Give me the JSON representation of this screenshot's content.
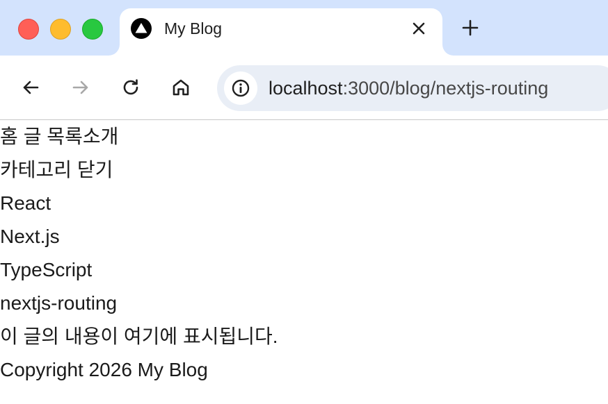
{
  "browser": {
    "tab": {
      "title": "My Blog",
      "close_glyph": "✕",
      "favicon": "nextjs-logo-icon"
    },
    "new_tab_glyph": "+",
    "url": {
      "host": "localhost",
      "rest": ":3000/blog/nextjs-routing"
    },
    "icons": {
      "back": "back-arrow-icon",
      "forward": "forward-arrow-icon",
      "reload": "reload-icon",
      "home": "home-icon",
      "site_info": "info-icon"
    },
    "colors": {
      "tabstrip": "#d3e3fd",
      "omnibox": "#e9eef6",
      "red": "#ff5f57",
      "yellow": "#febc2e",
      "green": "#28c840"
    }
  },
  "page": {
    "nav": {
      "home": "홈",
      "posts": "글 목록",
      "about": "소개"
    },
    "category_toggle": "카테고리 닫기",
    "categories": [
      "React",
      "Next.js",
      "TypeScript"
    ],
    "slug": "nextjs-routing",
    "body": "이 글의 내용이 여기에 표시됩니다.",
    "footer": "Copyright 2026 My Blog"
  }
}
